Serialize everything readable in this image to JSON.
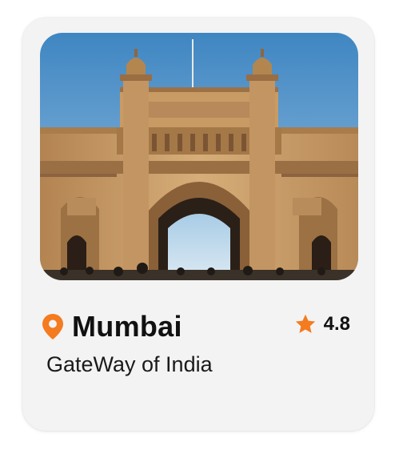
{
  "card": {
    "city": "Mumbai",
    "landmark": "GateWay of India",
    "rating": "4.8",
    "icons": {
      "location": "location-pin-icon",
      "rating": "star-icon"
    },
    "colors": {
      "accent": "#f47b20",
      "card_bg": "#f3f3f3",
      "text": "#111111"
    }
  }
}
